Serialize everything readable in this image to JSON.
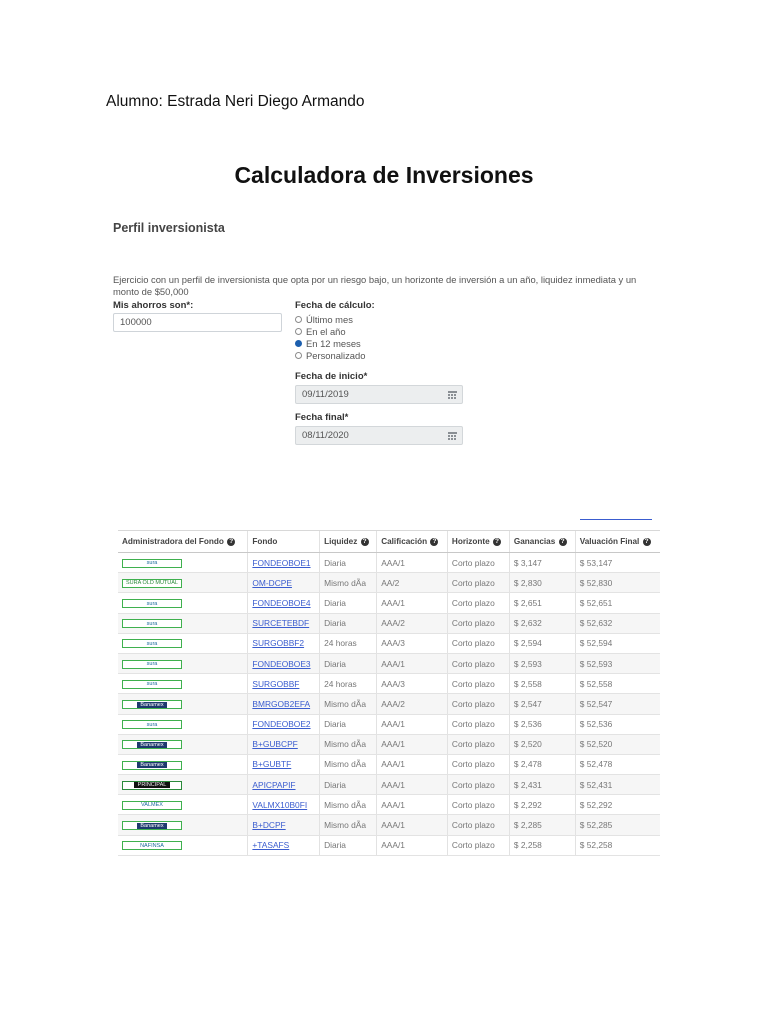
{
  "student": "Alumno: Estrada Neri Diego Armando",
  "title": "Calculadora de Inversiones",
  "profile": {
    "title": "Perfil inversionista",
    "description": "Ejercicio con un perfil de inversionista que opta por un riesgo bajo, un horizonte de inversión a un año, liquidez inmediata y un monto de $50,000"
  },
  "form": {
    "savings_label": "Mis ahorros son*:",
    "savings_value": "100000",
    "calc_date_label": "Fecha de cálculo:",
    "options": [
      "Último mes",
      "En el año",
      "En 12 meses",
      "Personalizado"
    ],
    "selected_option": "En 12 meses",
    "start_label": "Fecha de inicio*",
    "start_value": "09/11/2019",
    "end_label": "Fecha final*",
    "end_value": "08/11/2020",
    "calendar_icon": "calendar-icon"
  },
  "table": {
    "headers": [
      "Administradora del Fondo",
      "Fondo",
      "Liquidez",
      "Calificación",
      "Horizonte",
      "Ganancias",
      "Valuación Final"
    ],
    "info_icon": "?",
    "rows": [
      {
        "admin": "sura",
        "fondo": "FONDEOBOE1",
        "liquidez": "Diaria",
        "calif": "AAA/1",
        "horizonte": "Corto plazo",
        "ganancias": "$ 3,147",
        "valuacion": "$ 53,147"
      },
      {
        "admin": "SURA OLD MUTUAL",
        "fondo": "OM-DCPE",
        "liquidez": "Mismo dÃa",
        "calif": "AA/2",
        "horizonte": "Corto plazo",
        "ganancias": "$ 2,830",
        "valuacion": "$ 52,830"
      },
      {
        "admin": "sura",
        "fondo": "FONDEOBOE4",
        "liquidez": "Diaria",
        "calif": "AAA/1",
        "horizonte": "Corto plazo",
        "ganancias": "$ 2,651",
        "valuacion": "$ 52,651"
      },
      {
        "admin": "sura",
        "fondo": "SURCETEBDF",
        "liquidez": "Diaria",
        "calif": "AAA/2",
        "horizonte": "Corto plazo",
        "ganancias": "$ 2,632",
        "valuacion": "$ 52,632"
      },
      {
        "admin": "sura",
        "fondo": "SURGOBBF2",
        "liquidez": "24 horas",
        "calif": "AAA/3",
        "horizonte": "Corto plazo",
        "ganancias": "$ 2,594",
        "valuacion": "$ 52,594"
      },
      {
        "admin": "sura",
        "fondo": "FONDEOBOE3",
        "liquidez": "Diaria",
        "calif": "AAA/1",
        "horizonte": "Corto plazo",
        "ganancias": "$ 2,593",
        "valuacion": "$ 52,593"
      },
      {
        "admin": "sura",
        "fondo": "SURGOBBF",
        "liquidez": "24 horas",
        "calif": "AAA/3",
        "horizonte": "Corto plazo",
        "ganancias": "$ 2,558",
        "valuacion": "$ 52,558"
      },
      {
        "admin": "Banamex",
        "fondo": "BMRGOB2EFA",
        "liquidez": "Mismo dÃa",
        "calif": "AAA/2",
        "horizonte": "Corto plazo",
        "ganancias": "$ 2,547",
        "valuacion": "$ 52,547"
      },
      {
        "admin": "sura",
        "fondo": "FONDEOBOE2",
        "liquidez": "Diaria",
        "calif": "AAA/1",
        "horizonte": "Corto plazo",
        "ganancias": "$ 2,536",
        "valuacion": "$ 52,536"
      },
      {
        "admin": "Banamex",
        "fondo": "B+GUBCPF",
        "liquidez": "Mismo dÃa",
        "calif": "AAA/1",
        "horizonte": "Corto plazo",
        "ganancias": "$ 2,520",
        "valuacion": "$ 52,520"
      },
      {
        "admin": "Banamex",
        "fondo": "B+GUBTF",
        "liquidez": "Mismo dÃa",
        "calif": "AAA/1",
        "horizonte": "Corto plazo",
        "ganancias": "$ 2,478",
        "valuacion": "$ 52,478"
      },
      {
        "admin": "PRINCIPAL",
        "fondo": "APICPAPIF",
        "liquidez": "Diaria",
        "calif": "AAA/1",
        "horizonte": "Corto plazo",
        "ganancias": "$ 2,431",
        "valuacion": "$ 52,431"
      },
      {
        "admin": "VALMEX",
        "fondo": "VALMX10B0FI",
        "liquidez": "Mismo dÃa",
        "calif": "AAA/1",
        "horizonte": "Corto plazo",
        "ganancias": "$ 2,292",
        "valuacion": "$ 52,292"
      },
      {
        "admin": "Banamex",
        "fondo": "B+DCPF",
        "liquidez": "Mismo dÃa",
        "calif": "AAA/1",
        "horizonte": "Corto plazo",
        "ganancias": "$ 2,285",
        "valuacion": "$ 52,285"
      },
      {
        "admin": "NAFINSA",
        "fondo": "+TASAFS",
        "liquidez": "Diaria",
        "calif": "AAA/1",
        "horizonte": "Corto plazo",
        "ganancias": "$ 2,258",
        "valuacion": "$ 52,258"
      }
    ]
  }
}
